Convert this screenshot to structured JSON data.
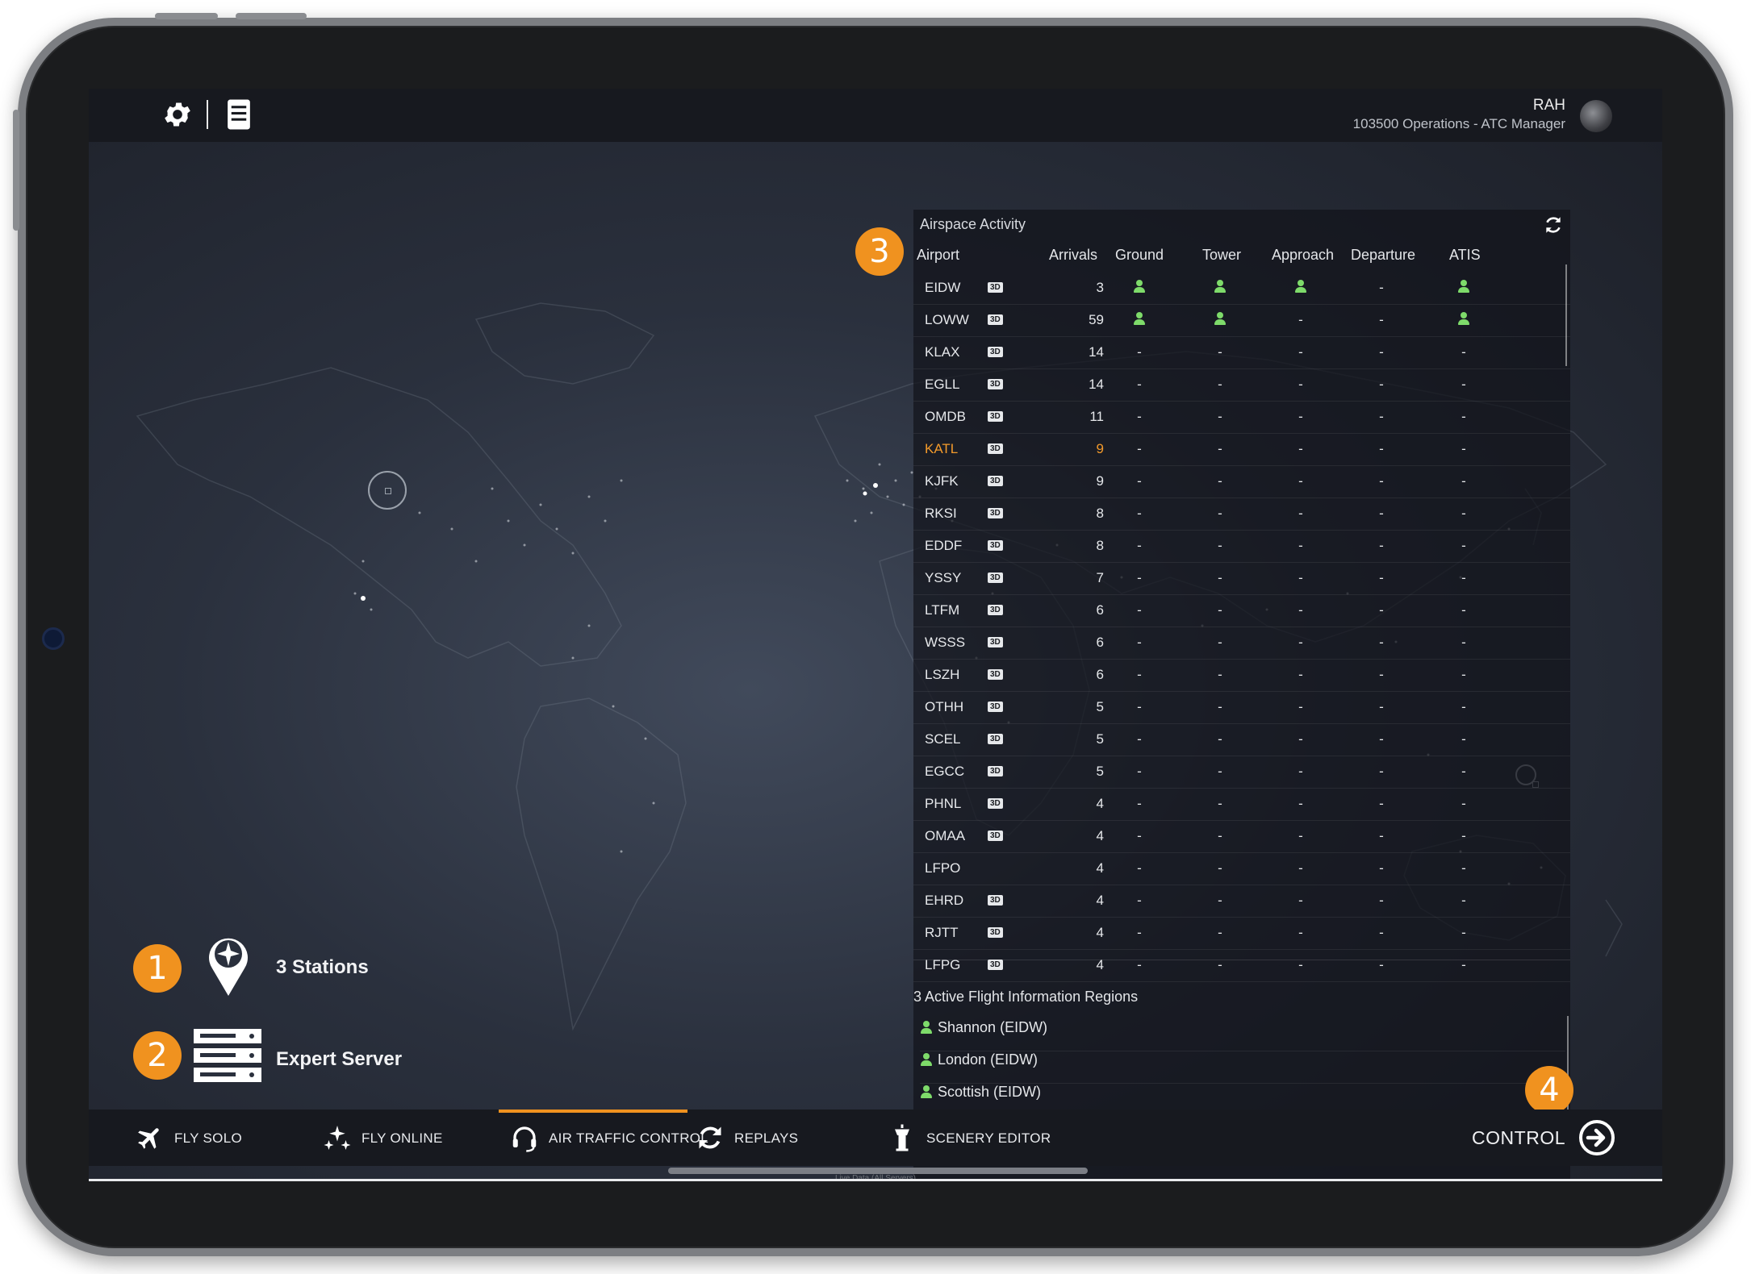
{
  "user": {
    "name": "RAH",
    "role": "103500 Operations - ATC Manager"
  },
  "panel": {
    "title": "Airspace Activity",
    "columns": [
      "Airport",
      "Arrivals",
      "Ground",
      "Tower",
      "Approach",
      "Departure",
      "ATIS"
    ],
    "rows": [
      {
        "code": "EIDW",
        "has3d": true,
        "arrivals": "3",
        "ground": "person",
        "tower": "person",
        "approach": "person",
        "departure": "-",
        "atis": "person"
      },
      {
        "code": "LOWW",
        "has3d": true,
        "arrivals": "59",
        "ground": "person",
        "tower": "person",
        "approach": "-",
        "departure": "-",
        "atis": "person"
      },
      {
        "code": "KLAX",
        "has3d": true,
        "arrivals": "14",
        "ground": "-",
        "tower": "-",
        "approach": "-",
        "departure": "-",
        "atis": "-"
      },
      {
        "code": "EGLL",
        "has3d": true,
        "arrivals": "14",
        "ground": "-",
        "tower": "-",
        "approach": "-",
        "departure": "-",
        "atis": "-"
      },
      {
        "code": "OMDB",
        "has3d": true,
        "arrivals": "11",
        "ground": "-",
        "tower": "-",
        "approach": "-",
        "departure": "-",
        "atis": "-"
      },
      {
        "code": "KATL",
        "has3d": true,
        "arrivals": "9",
        "ground": "-",
        "tower": "-",
        "approach": "-",
        "departure": "-",
        "atis": "-",
        "highlight": true
      },
      {
        "code": "KJFK",
        "has3d": true,
        "arrivals": "9",
        "ground": "-",
        "tower": "-",
        "approach": "-",
        "departure": "-",
        "atis": "-"
      },
      {
        "code": "RKSI",
        "has3d": true,
        "arrivals": "8",
        "ground": "-",
        "tower": "-",
        "approach": "-",
        "departure": "-",
        "atis": "-"
      },
      {
        "code": "EDDF",
        "has3d": true,
        "arrivals": "8",
        "ground": "-",
        "tower": "-",
        "approach": "-",
        "departure": "-",
        "atis": "-"
      },
      {
        "code": "YSSY",
        "has3d": true,
        "arrivals": "7",
        "ground": "-",
        "tower": "-",
        "approach": "-",
        "departure": "-",
        "atis": "-"
      },
      {
        "code": "LTFM",
        "has3d": true,
        "arrivals": "6",
        "ground": "-",
        "tower": "-",
        "approach": "-",
        "departure": "-",
        "atis": "-"
      },
      {
        "code": "WSSS",
        "has3d": true,
        "arrivals": "6",
        "ground": "-",
        "tower": "-",
        "approach": "-",
        "departure": "-",
        "atis": "-"
      },
      {
        "code": "LSZH",
        "has3d": true,
        "arrivals": "6",
        "ground": "-",
        "tower": "-",
        "approach": "-",
        "departure": "-",
        "atis": "-"
      },
      {
        "code": "OTHH",
        "has3d": true,
        "arrivals": "5",
        "ground": "-",
        "tower": "-",
        "approach": "-",
        "departure": "-",
        "atis": "-"
      },
      {
        "code": "SCEL",
        "has3d": true,
        "arrivals": "5",
        "ground": "-",
        "tower": "-",
        "approach": "-",
        "departure": "-",
        "atis": "-"
      },
      {
        "code": "EGCC",
        "has3d": true,
        "arrivals": "5",
        "ground": "-",
        "tower": "-",
        "approach": "-",
        "departure": "-",
        "atis": "-"
      },
      {
        "code": "PHNL",
        "has3d": true,
        "arrivals": "4",
        "ground": "-",
        "tower": "-",
        "approach": "-",
        "departure": "-",
        "atis": "-"
      },
      {
        "code": "OMAA",
        "has3d": true,
        "arrivals": "4",
        "ground": "-",
        "tower": "-",
        "approach": "-",
        "departure": "-",
        "atis": "-"
      },
      {
        "code": "LFPO",
        "has3d": false,
        "arrivals": "4",
        "ground": "-",
        "tower": "-",
        "approach": "-",
        "departure": "-",
        "atis": "-"
      },
      {
        "code": "EHRD",
        "has3d": true,
        "arrivals": "4",
        "ground": "-",
        "tower": "-",
        "approach": "-",
        "departure": "-",
        "atis": "-"
      },
      {
        "code": "RJTT",
        "has3d": true,
        "arrivals": "4",
        "ground": "-",
        "tower": "-",
        "approach": "-",
        "departure": "-",
        "atis": "-"
      },
      {
        "code": "LFPG",
        "has3d": true,
        "arrivals": "4",
        "ground": "-",
        "tower": "-",
        "approach": "-",
        "departure": "-",
        "atis": "-"
      }
    ],
    "badge_3d": "3D",
    "fir_title": "3 Active Flight Information Regions",
    "fir_items": [
      "Shannon (EIDW)",
      "London (EIDW)",
      "Scottish (EIDW)"
    ]
  },
  "info": {
    "stations": "3 Stations",
    "server": "Expert Server"
  },
  "callouts": [
    "1",
    "2",
    "3",
    "4"
  ],
  "nav": {
    "items": [
      {
        "label": "FLY SOLO",
        "icon": "plane-icon"
      },
      {
        "label": "FLY ONLINE",
        "icon": "multi-plane-icon"
      },
      {
        "label": "AIR TRAFFIC CONTROL",
        "icon": "headset-icon",
        "active": true
      },
      {
        "label": "REPLAYS",
        "icon": "refresh-icon"
      },
      {
        "label": "SCENERY EDITOR",
        "icon": "tower-icon"
      }
    ],
    "control_label": "CONTROL",
    "live_data": "Live Data (All Servers)"
  },
  "colors": {
    "accent": "#f0921f",
    "controller_online": "#7edb6a",
    "highlight_row": "#f39a2b"
  }
}
